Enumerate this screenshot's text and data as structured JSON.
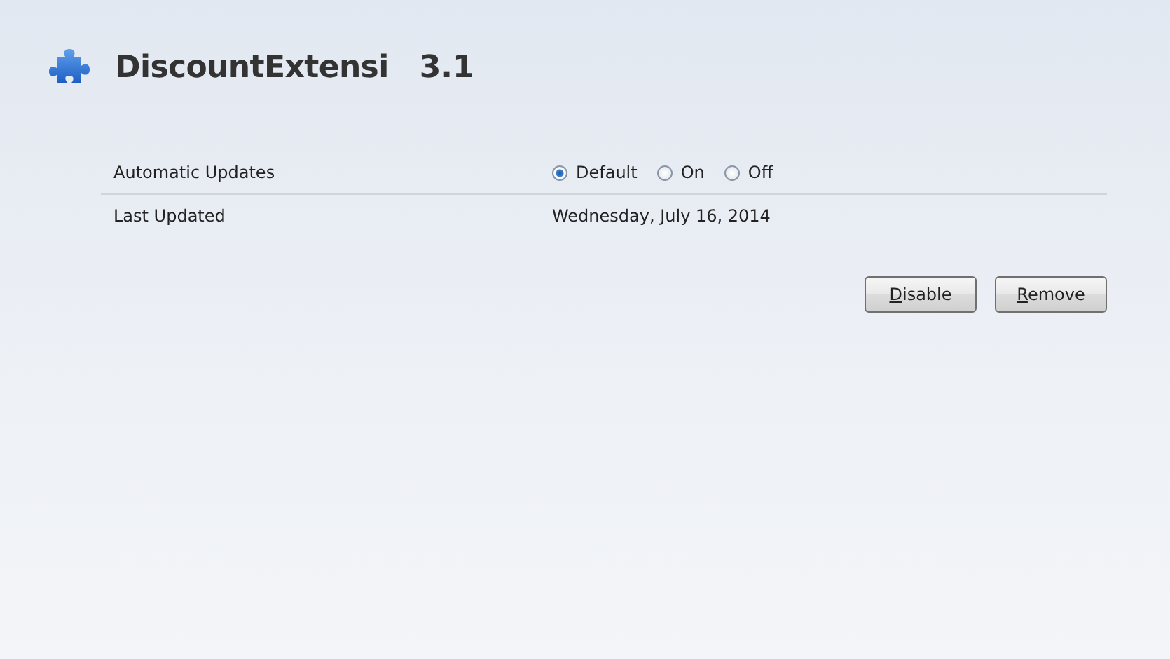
{
  "addon": {
    "name": "DiscountExtensi",
    "version": "3.1"
  },
  "details": [
    {
      "kind": "radios",
      "label": "Automatic Updates",
      "options": [
        {
          "label": "Default",
          "selected": true
        },
        {
          "label": "On",
          "selected": false
        },
        {
          "label": "Off",
          "selected": false
        }
      ]
    },
    {
      "kind": "text",
      "label": "Last Updated",
      "value": "Wednesday, July 16, 2014"
    }
  ],
  "buttons": [
    {
      "label": "Disable",
      "mnemonic_underlined": true
    },
    {
      "label": "Remove",
      "mnemonic_underlined": true
    }
  ]
}
